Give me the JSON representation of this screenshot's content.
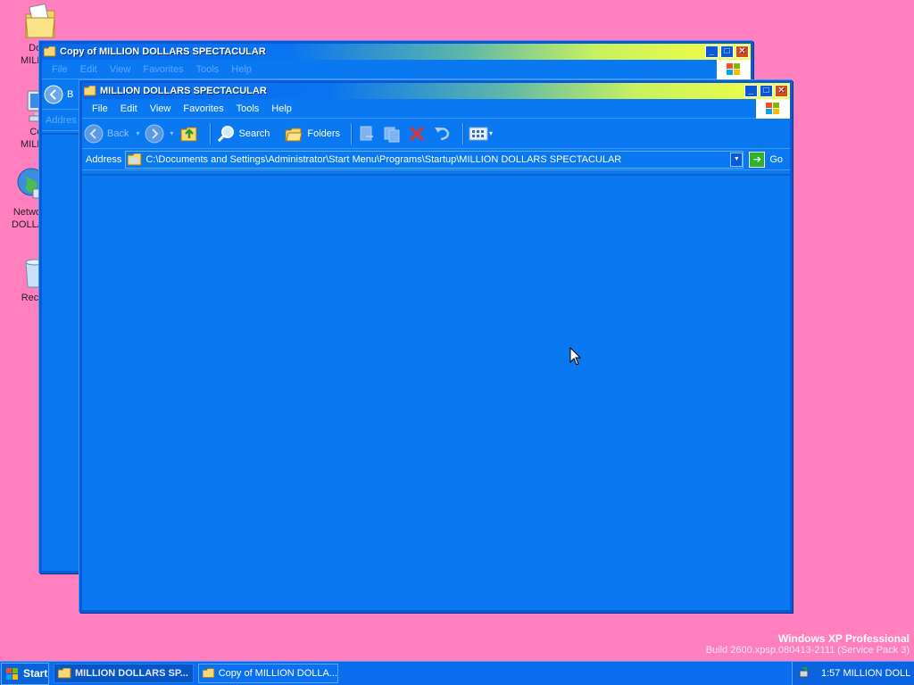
{
  "desktop": {
    "background_color": "#ff7fbf",
    "icons": [
      {
        "label_line1": "Docu",
        "label_line2": "MILLION",
        "icon": "my-documents-icon"
      },
      {
        "label_line1": "Com",
        "label_line2": "MILLION",
        "icon": "my-computer-icon"
      },
      {
        "label_line1": "Network",
        "label_line2": "DOLLAR",
        "icon": "network-places-icon"
      },
      {
        "label_line1": "Recyc",
        "label_line2": "",
        "icon": "recycle-bin-icon"
      }
    ]
  },
  "back_window": {
    "title": "Copy of MILLION DOLLARS SPECTACULAR",
    "menu": [
      "File",
      "Edit",
      "View",
      "Favorites",
      "Tools",
      "Help"
    ],
    "toolbar_partial": "B",
    "address_label": "Addres"
  },
  "front_window": {
    "title": "MILLION DOLLARS SPECTACULAR",
    "menu": [
      "File",
      "Edit",
      "View",
      "Favorites",
      "Tools",
      "Help"
    ],
    "toolbar": {
      "back_label": "Back",
      "search_label": "Search",
      "folders_label": "Folders"
    },
    "address": {
      "label": "Address",
      "path": "C:\\Documents and Settings\\Administrator\\Start Menu\\Programs\\Startup\\MILLION DOLLARS SPECTACULAR",
      "go_label": "Go"
    }
  },
  "watermark": {
    "title": "Windows XP Professional",
    "build": "Build 2600.xpsp.080413-2111 (Service Pack 3)"
  },
  "taskbar": {
    "start_label": "Start",
    "tasks": [
      {
        "label": "MILLION DOLLARS SP...",
        "active": true
      },
      {
        "label": "Copy of MILLION DOLLA...",
        "active": false
      }
    ],
    "clock": "1:57 MILLION DOLL"
  },
  "colors": {
    "window_blue": "#0a78f0",
    "taskbar_blue": "#0a6df0",
    "title_gradient_end": "#f8ff40"
  }
}
